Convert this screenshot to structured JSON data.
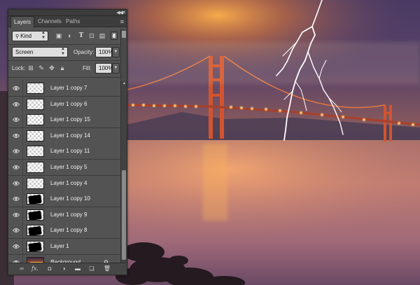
{
  "panel": {
    "tabs": [
      {
        "label": "Layers",
        "active": true
      },
      {
        "label": "Channels",
        "active": false
      },
      {
        "label": "Paths",
        "active": false
      }
    ],
    "filter": {
      "label": "Kind"
    },
    "blend_mode": "Screen",
    "opacity_label": "Opacity:",
    "opacity_value": "100%",
    "lock_label": "Lock:",
    "fill_label": "Fill:",
    "fill_value": "100%",
    "layers": [
      {
        "name": "Layer 1 copy 7",
        "thumb": "transparent"
      },
      {
        "name": "Layer 1 copy 6",
        "thumb": "transparent"
      },
      {
        "name": "Layer 1 copy 15",
        "thumb": "transparent"
      },
      {
        "name": "Layer 1 copy 14",
        "thumb": "transparent"
      },
      {
        "name": "Layer 1 copy 11",
        "thumb": "transparent"
      },
      {
        "name": "Layer 1 copy 5",
        "thumb": "transparent"
      },
      {
        "name": "Layer 1 copy 4",
        "thumb": "transparent"
      },
      {
        "name": "Layer 1 copy 10",
        "thumb": "black"
      },
      {
        "name": "Layer 1 copy 9",
        "thumb": "black"
      },
      {
        "name": "Layer 1 copy 8",
        "thumb": "black"
      },
      {
        "name": "Layer 1",
        "thumb": "black"
      },
      {
        "name": "Background",
        "thumb": "photo",
        "italic": true,
        "locked": true
      }
    ],
    "footer_icons": [
      "link-icon",
      "fx-icon",
      "mask-icon",
      "adjustment-icon",
      "folder-icon",
      "new-layer-icon",
      "trash-icon"
    ],
    "fx_label": "fx."
  },
  "colors": {
    "panel_bg": "#535353",
    "panel_dark": "#3d3d3d",
    "bridge_orange": "#e0562a",
    "light_glow": "#ffcf6a"
  }
}
